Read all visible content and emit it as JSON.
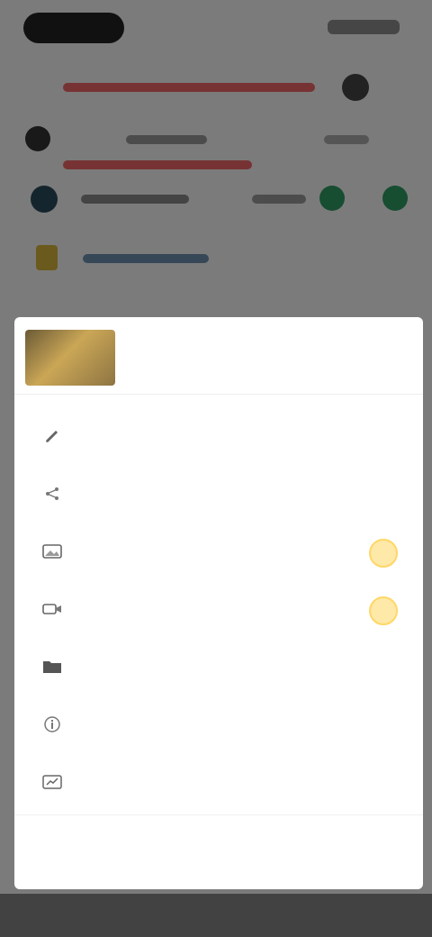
{
  "sheet": {
    "title": "",
    "menu": [
      {
        "label": "",
        "icon": "pencil-icon"
      },
      {
        "label": "",
        "icon": "share-icon"
      },
      {
        "label": "",
        "icon": "image-icon"
      },
      {
        "label": "",
        "icon": "video-icon"
      },
      {
        "label": "",
        "icon": "folder-icon"
      },
      {
        "label": "",
        "icon": "info-icon"
      },
      {
        "label": "",
        "icon": "chart-icon"
      }
    ],
    "logout_label": ""
  },
  "colors": {
    "overlay": "#000000",
    "danger": "#ff4a4a",
    "badge": "#ffd766",
    "accent_green": "#2e9a62"
  }
}
